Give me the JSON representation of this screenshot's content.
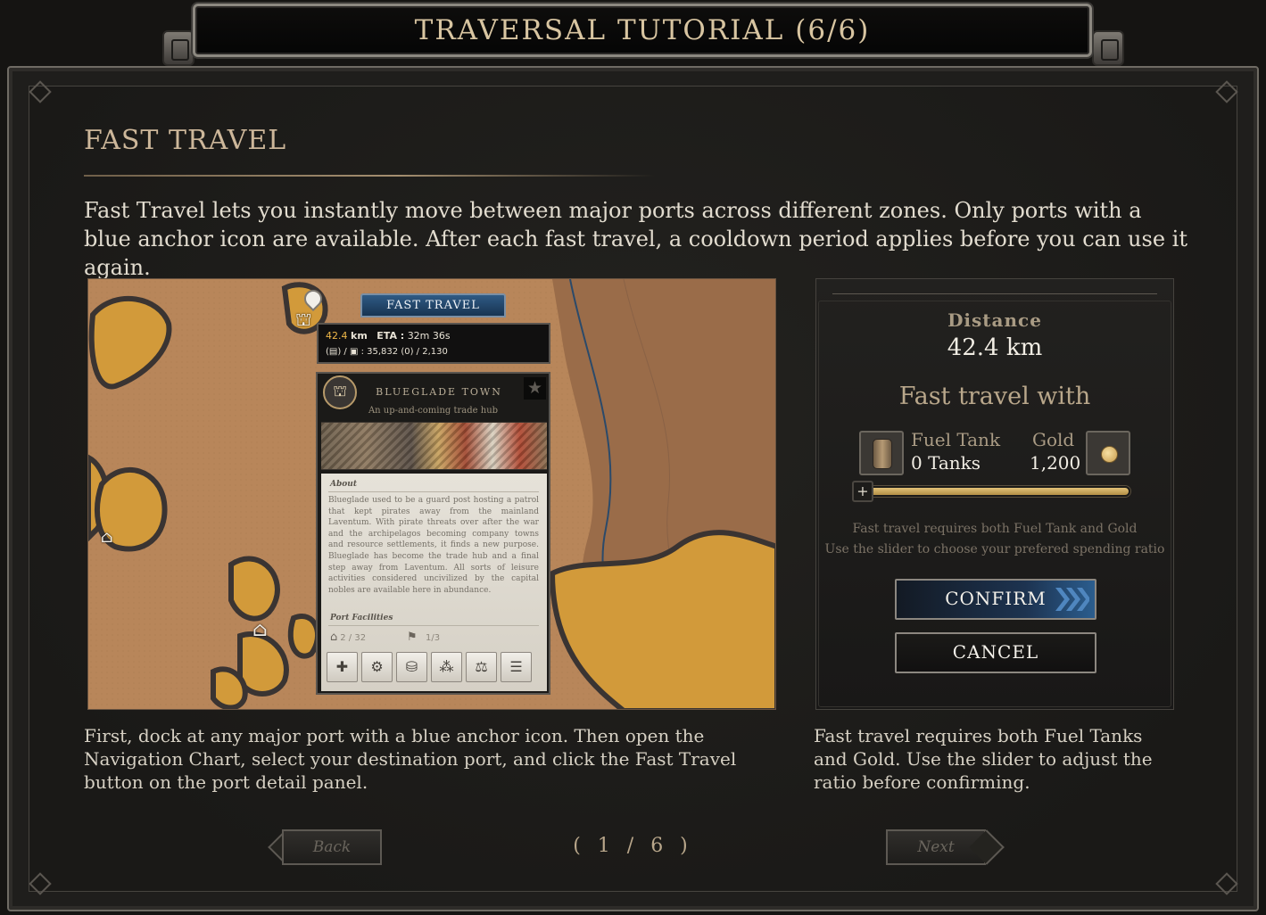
{
  "window": {
    "title": "TRAVERSAL TUTORIAL (6/6)"
  },
  "section": {
    "title": "FAST TRAVEL",
    "intro": "Fast Travel lets you instantly move between major ports across different zones. Only ports with a blue anchor icon are available. After each fast travel, a cooldown period applies before you can use it again."
  },
  "map_screenshot": {
    "fast_travel_tab": "FAST TRAVEL",
    "distance_value": "42.4",
    "distance_unit": "km",
    "eta_label": "ETA :",
    "eta_value": "32m 36s",
    "cost_line": "(▤) / ▣ : 35,832 (0) / 2,130",
    "port": {
      "icon": "town-hall-icon",
      "name": "BLUEGLADE TOWN",
      "subtitle": "An up-and-coming trade hub",
      "about_heading": "About",
      "about_text": "Blueglade used to be a guard post hosting a patrol that kept pirates away from the mainland Laventum. With pirate threats over after the war and the archipelagos becoming company towns and resource settlements, it finds a new purpose. Blueglade has become the trade hub and a final step away from Laventum. All sorts of leisure activities considered uncivilized by the capital nobles are available here in abundance.",
      "facilities_heading": "Port Facilities",
      "facility_1": "2 / 32",
      "facility_2": "1/3",
      "facility_buttons": [
        "repair-icon",
        "gear-icon",
        "cargo-icon",
        "network-icon",
        "trade-icon",
        "scroll-icon"
      ]
    }
  },
  "map_caption": "First, dock at any major port with a blue anchor icon. Then open the Navigation Chart, select your destination port, and click the Fast Travel button on the port detail panel.",
  "travel_panel": {
    "distance_label": "Distance",
    "distance_value": "42.4 km",
    "with_label": "Fast travel with",
    "fuel_label": "Fuel Tank",
    "fuel_value": "0 Tanks",
    "gold_label": "Gold",
    "gold_value": "1,200",
    "slider_ratio": 0.0,
    "note_line1": "Fast travel requires both Fuel Tank and Gold",
    "note_line2": "Use the slider to choose your prefered spending ratio",
    "confirm_label": "CONFIRM",
    "cancel_label": "CANCEL"
  },
  "panel_caption": "Fast travel requires both Fuel Tanks and Gold. Use the slider to adjust the ratio before confirming.",
  "nav": {
    "back_label": "Back",
    "next_label": "Next",
    "pager": "( 1 / 6 )"
  },
  "colors": {
    "accent_gold": "#cdb79a",
    "confirm_blue": "#2b5d8e",
    "map_sand": "#b8865a",
    "map_island": "#d29a3a"
  }
}
